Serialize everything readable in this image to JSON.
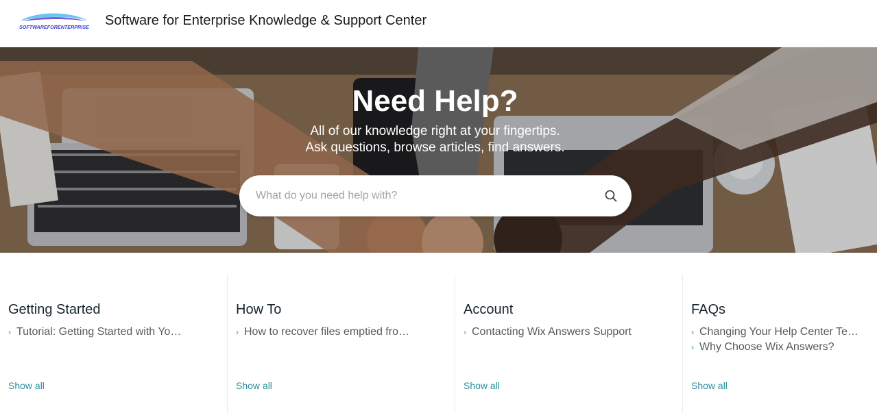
{
  "header": {
    "logo_text": "SOFTWAREFORENTERPRISE",
    "title": "Software for Enterprise Knowledge & Support Center"
  },
  "hero": {
    "heading": "Need Help?",
    "subtitle_line1": "All of our knowledge right at your fingertips.",
    "subtitle_line2": "Ask questions, browse articles, find answers.",
    "search": {
      "placeholder": "What do you need help with?",
      "value": "",
      "icon": "search-icon"
    }
  },
  "categories": [
    {
      "title": "Getting Started",
      "articles": [
        "Tutorial: Getting Started with Your Help Center"
      ],
      "show_all": "Show all"
    },
    {
      "title": "How To",
      "articles": [
        "How to recover files emptied from the trash"
      ],
      "show_all": "Show all"
    },
    {
      "title": "Account",
      "articles": [
        "Contacting Wix Answers Support"
      ],
      "show_all": "Show all"
    },
    {
      "title": "FAQs",
      "articles": [
        "Changing Your Help Center Template",
        "Why Choose Wix Answers?"
      ],
      "show_all": "Show all"
    }
  ],
  "colors": {
    "accent": "#2a8f9d",
    "heading": "#16252d",
    "body_text": "#555a5c"
  }
}
